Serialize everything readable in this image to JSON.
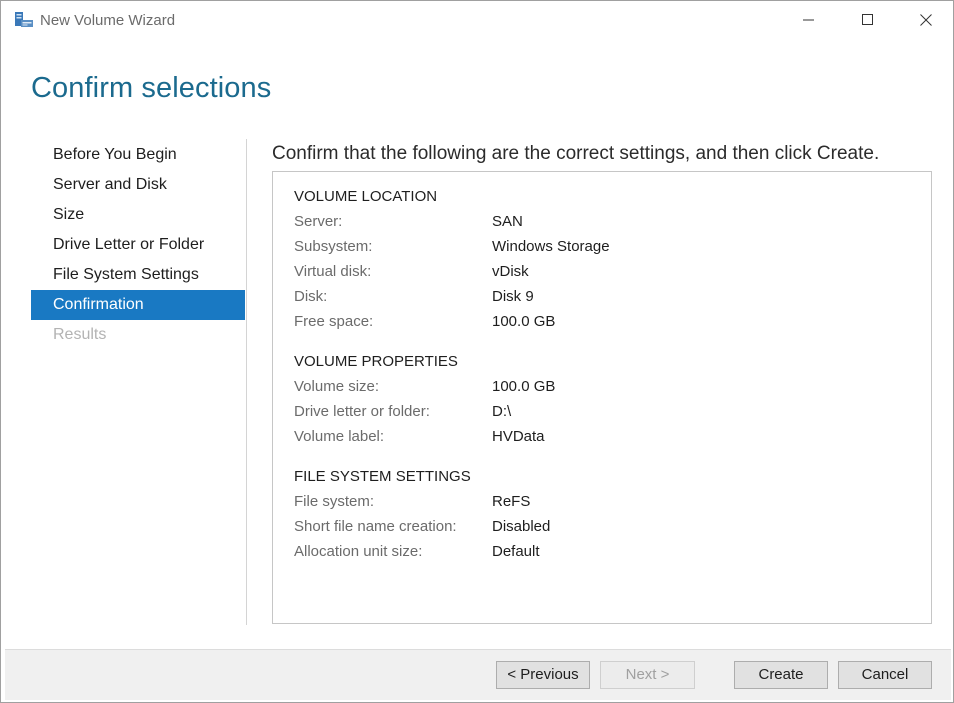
{
  "window": {
    "title": "New Volume Wizard",
    "controls": {
      "minimize": "minimize",
      "maximize": "maximize",
      "close": "close"
    }
  },
  "header": {
    "title": "Confirm selections"
  },
  "nav": {
    "items": [
      {
        "label": "Before You Begin",
        "state": "normal"
      },
      {
        "label": "Server and Disk",
        "state": "normal"
      },
      {
        "label": "Size",
        "state": "normal"
      },
      {
        "label": "Drive Letter or Folder",
        "state": "normal"
      },
      {
        "label": "File System Settings",
        "state": "normal"
      },
      {
        "label": "Confirmation",
        "state": "active"
      },
      {
        "label": "Results",
        "state": "disabled"
      }
    ]
  },
  "main": {
    "instruction": "Confirm that the following are the correct settings, and then click Create.",
    "sections": [
      {
        "title": "VOLUME LOCATION",
        "rows": [
          {
            "label": "Server:",
            "value": "SAN"
          },
          {
            "label": "Subsystem:",
            "value": "Windows Storage"
          },
          {
            "label": "Virtual disk:",
            "value": "vDisk"
          },
          {
            "label": "Disk:",
            "value": "Disk 9"
          },
          {
            "label": "Free space:",
            "value": "100.0 GB"
          }
        ]
      },
      {
        "title": "VOLUME PROPERTIES",
        "rows": [
          {
            "label": "Volume size:",
            "value": "100.0 GB"
          },
          {
            "label": "Drive letter or folder:",
            "value": "D:\\"
          },
          {
            "label": "Volume label:",
            "value": "HVData"
          }
        ]
      },
      {
        "title": "FILE SYSTEM SETTINGS",
        "rows": [
          {
            "label": "File system:",
            "value": "ReFS"
          },
          {
            "label": "Short file name creation:",
            "value": "Disabled"
          },
          {
            "label": "Allocation unit size:",
            "value": "Default"
          }
        ]
      }
    ]
  },
  "footer": {
    "previous_label": "< Previous",
    "next_label": "Next >",
    "create_label": "Create",
    "cancel_label": "Cancel"
  },
  "colors": {
    "accent": "#1979c3",
    "title": "#1b6a8e",
    "label_gray": "#6b6b6b",
    "disabled": "#b3b3b3"
  }
}
